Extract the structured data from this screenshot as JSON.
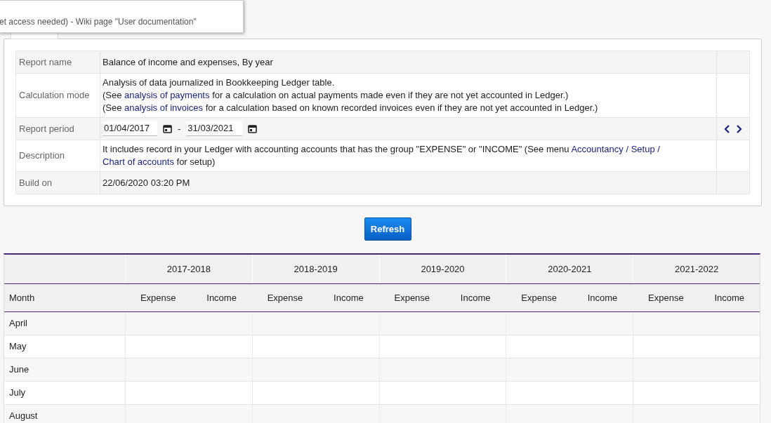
{
  "tooltip": {
    "text": "et access needed) - Wiki page \"User documentation\""
  },
  "report_info": [
    {
      "label": "Report name",
      "kind": "text",
      "lines": [
        [
          {
            "kind": "text",
            "text": "Balance of income and expenses, By year"
          }
        ]
      ]
    },
    {
      "label": "Calculation mode",
      "kind": "text",
      "lines": [
        [
          {
            "kind": "text",
            "text": "Analysis of data journalized in Bookkeeping Ledger table."
          }
        ],
        [
          {
            "kind": "text",
            "text": "(See"
          },
          {
            "kind": "link",
            "text": "analysis of payments"
          },
          {
            "kind": "text",
            "text": "for a calculation on actual payments made even if they are not yet accounted in Ledger.)"
          }
        ],
        [
          {
            "kind": "text",
            "text": "(See"
          },
          {
            "kind": "link",
            "text": "analysis of invoices"
          },
          {
            "kind": "text",
            "text": "for a calculation based on known recorded invoices even if they are not yet accounted in Ledger.)"
          }
        ]
      ]
    },
    {
      "label": "Report period",
      "kind": "period",
      "from": "01/04/2017",
      "separator": "-",
      "to": "31/03/2021"
    },
    {
      "label": "Description",
      "kind": "text",
      "lines": [
        [
          {
            "kind": "text",
            "text": "It includes record in your Ledger with accounting accounts that has the group \"EXPENSE\" or \"INCOME\" (See menu"
          },
          {
            "kind": "link",
            "text": "Accountancy / Setup /"
          },
          {
            "kind": "link",
            "text": "Chart of accounts"
          },
          {
            "kind": "text",
            "text": "for setup)"
          }
        ]
      ]
    },
    {
      "label": "Build on",
      "kind": "text",
      "lines": [
        [
          {
            "kind": "text",
            "text": "22/06/2020 03:20 PM"
          }
        ]
      ]
    }
  ],
  "refresh_button": "Refresh",
  "table": {
    "month_header": "Month",
    "years": [
      {
        "label": "2017-2018",
        "columns": [
          "Expense",
          "Income"
        ]
      },
      {
        "label": "2018-2019",
        "columns": [
          "Expense",
          "Income"
        ]
      },
      {
        "label": "2019-2020",
        "columns": [
          "Expense",
          "Income"
        ]
      },
      {
        "label": "2020-2021",
        "columns": [
          "Expense",
          "Income"
        ]
      },
      {
        "label": "2021-2022",
        "columns": [
          "Expense",
          "Income"
        ]
      }
    ],
    "rows": [
      "April",
      "May",
      "June",
      "July",
      "August"
    ]
  }
}
